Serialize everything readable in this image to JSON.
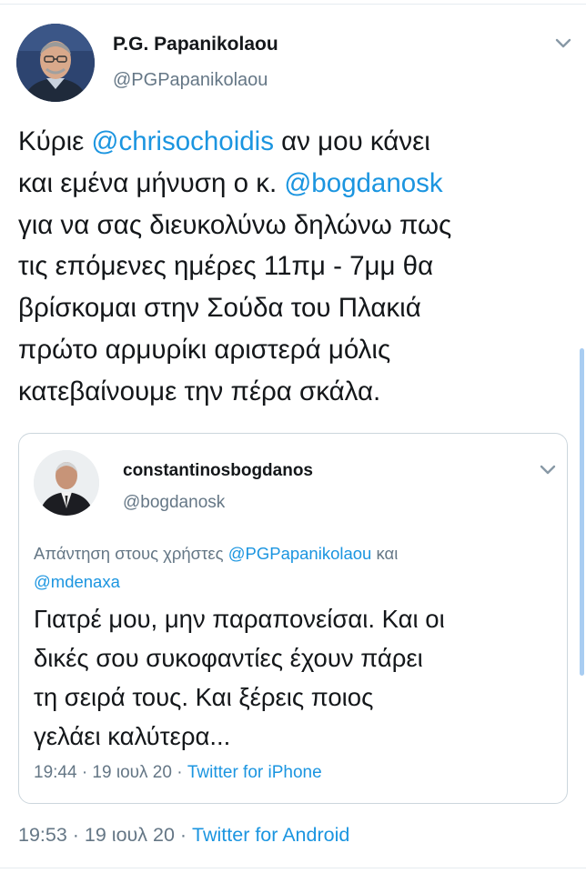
{
  "tweet": {
    "author_name": "P.G. Papanikolaou",
    "author_handle": "@PGPapanikolaou",
    "lines": {
      "l1_pre": "Κύριε ",
      "l1_mention": "@chrisochoidis",
      "l1_post": " αν μου κάνει",
      "l2_pre": "και εμένα μήνυση ο κ. ",
      "l2_mention": "@bogdanosk",
      "l3": "για να σας διευκολύνω δηλώνω πως",
      "l4": "τις επόμενες ημέρες 11πμ - 7μμ θα",
      "l5": "βρίσκομαι στην Σούδα του Πλακιά",
      "l6": "πρώτο αρμυρίκι αριστερά μόλις",
      "l7": "κατεβαίνουμε την πέρα σκάλα."
    },
    "timestamp": "19:53 · 19 ιουλ 20 · ",
    "source": "Twitter for Android"
  },
  "quoted": {
    "author_name": "constantinosbogdanos",
    "author_handle": "@bogdanosk",
    "reply_prefix": "Απάντηση στους χρήστες ",
    "reply_user1": "@PGPapanikolaou",
    "reply_and": " και",
    "reply_user2": "@mdenaxa",
    "lines": {
      "l1": "Γιατρέ μου, μην παραπονείσαι. Και οι",
      "l2": "δικές σου συκοφαντίες έχουν πάρει",
      "l3": "τη σειρά τους. Και ξέρεις ποιος",
      "l4": "γελάει καλύτερα..."
    },
    "timestamp": "19:44 · 19 ιουλ 20 · ",
    "source": "Twitter for iPhone"
  },
  "icons": {
    "tweet_menu": "chevron-down-icon",
    "quote_menu": "chevron-down-icon"
  },
  "colors": {
    "link": "#1b95e0",
    "secondary_text": "#657786",
    "primary_text": "#14171a",
    "border": "#ccd6dd"
  }
}
